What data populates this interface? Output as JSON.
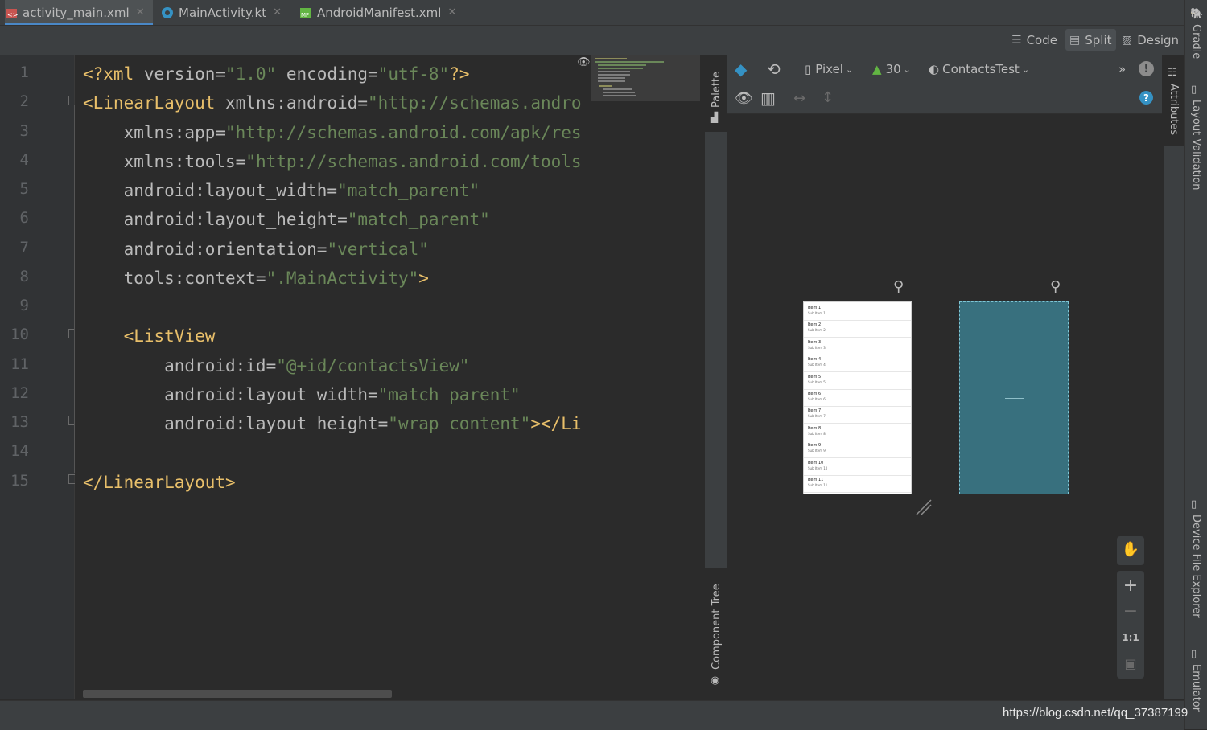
{
  "tabs": [
    {
      "label": "activity_main.xml",
      "icon": "xml-file-icon",
      "active": true
    },
    {
      "label": "MainActivity.kt",
      "icon": "kotlin-file-icon",
      "active": false
    },
    {
      "label": "AndroidManifest.xml",
      "icon": "manifest-file-icon",
      "active": false
    }
  ],
  "view_modes": {
    "code": "Code",
    "split": "Split",
    "design": "Design",
    "selected": "Split"
  },
  "editor": {
    "line_numbers": [
      "1",
      "2",
      "3",
      "4",
      "5",
      "6",
      "7",
      "8",
      "9",
      "10",
      "11",
      "12",
      "13",
      "14",
      "15"
    ],
    "lines": [
      [
        {
          "c": "t",
          "v": "<?xml "
        },
        {
          "c": "a",
          "v": "version="
        },
        {
          "c": "s",
          "v": "\"1.0\""
        },
        {
          "c": "a",
          "v": " encoding="
        },
        {
          "c": "s",
          "v": "\"utf-8\""
        },
        {
          "c": "t",
          "v": "?>"
        }
      ],
      [
        {
          "c": "t",
          "v": "<LinearLayout "
        },
        {
          "c": "a",
          "v": "xmlns:android="
        },
        {
          "c": "s",
          "v": "\"http://schemas.andro"
        }
      ],
      [
        {
          "c": "a",
          "v": "    xmlns:app="
        },
        {
          "c": "s",
          "v": "\"http://schemas.android.com/apk/res"
        }
      ],
      [
        {
          "c": "a",
          "v": "    xmlns:tools="
        },
        {
          "c": "s",
          "v": "\"http://schemas.android.com/tools"
        }
      ],
      [
        {
          "c": "a",
          "v": "    android:layout_width="
        },
        {
          "c": "s",
          "v": "\"match_parent\""
        }
      ],
      [
        {
          "c": "a",
          "v": "    android:layout_height="
        },
        {
          "c": "s",
          "v": "\"match_parent\""
        }
      ],
      [
        {
          "c": "a",
          "v": "    android:orientation="
        },
        {
          "c": "s",
          "v": "\"vertical\""
        }
      ],
      [
        {
          "c": "a",
          "v": "    tools:context="
        },
        {
          "c": "s",
          "v": "\".MainActivity\""
        },
        {
          "c": "t",
          "v": ">"
        }
      ],
      [],
      [
        {
          "c": "t",
          "v": "    <ListView"
        }
      ],
      [
        {
          "c": "a",
          "v": "        android:id="
        },
        {
          "c": "s",
          "v": "\"@+id/contactsView\""
        }
      ],
      [
        {
          "c": "a",
          "v": "        android:layout_width="
        },
        {
          "c": "s",
          "v": "\"match_parent\""
        }
      ],
      [
        {
          "c": "a",
          "v": "        android:layout_height="
        },
        {
          "c": "s",
          "v": "\"wrap_content\""
        },
        {
          "c": "t",
          "v": "></Li"
        }
      ],
      [],
      [
        {
          "c": "t",
          "v": "</LinearLayout>"
        }
      ]
    ]
  },
  "side_panels": {
    "palette": "Palette",
    "component_tree": "Component Tree",
    "attributes": "Attributes"
  },
  "design_toolbar": {
    "device": "Pixel",
    "api_level": "30",
    "theme": "ContactsTest",
    "overflow": "»"
  },
  "preview_list": [
    {
      "title": "Item 1",
      "sub": "Sub Item 1"
    },
    {
      "title": "Item 2",
      "sub": "Sub Item 2"
    },
    {
      "title": "Item 3",
      "sub": "Sub Item 3"
    },
    {
      "title": "Item 4",
      "sub": "Sub Item 4"
    },
    {
      "title": "Item 5",
      "sub": "Sub Item 5"
    },
    {
      "title": "Item 6",
      "sub": "Sub Item 6"
    },
    {
      "title": "Item 7",
      "sub": "Sub Item 7"
    },
    {
      "title": "Item 8",
      "sub": "Sub Item 8"
    },
    {
      "title": "Item 9",
      "sub": "Sub Item 9"
    },
    {
      "title": "Item 10",
      "sub": "Sub Item 10"
    },
    {
      "title": "Item 11",
      "sub": "Sub Item 11"
    }
  ],
  "zoom": {
    "zoom_in": "+",
    "zoom_out": "−",
    "actual_size": "1:1"
  },
  "right_bar": {
    "gradle": "Gradle",
    "layout_validation": "Layout Validation",
    "device_file_explorer": "Device File Explorer",
    "emulator": "Emulator"
  },
  "watermark": "https://blog.csdn.net/qq_37387199",
  "colors": {
    "tag": "#e8bf6a",
    "attr": "#bababa",
    "string": "#6a8759",
    "accent": "#4a88c7",
    "blueprint": "#38707e"
  }
}
